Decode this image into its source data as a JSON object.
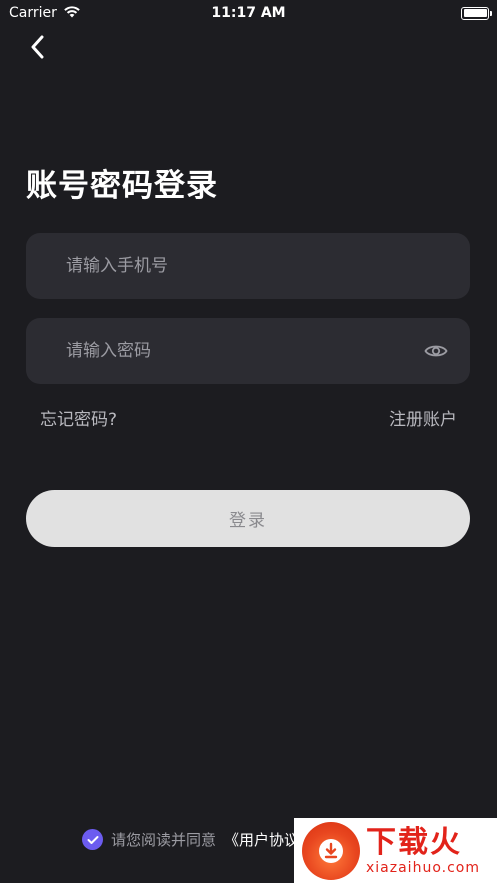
{
  "status_bar": {
    "carrier": "Carrier",
    "time": "11:17 AM"
  },
  "title": "账号密码登录",
  "phone": {
    "placeholder": "请输入手机号",
    "value": ""
  },
  "password": {
    "placeholder": "请输入密码",
    "value": ""
  },
  "links": {
    "forgot": "忘记密码?",
    "register": "注册账户"
  },
  "login_button": "登录",
  "agreement": {
    "text": "请您阅读并同意",
    "user_agreement": "《用户协议》"
  },
  "watermark": {
    "title": "下载火",
    "subtitle": "xiazaihuo.com"
  },
  "colors": {
    "background": "#1c1c20",
    "field": "#2c2c32",
    "button": "#e1e1e1",
    "check": "#6c5cf0",
    "brand_red": "#e2231a"
  },
  "icons": [
    "wifi-icon",
    "battery-icon",
    "back-chevron-icon",
    "eye-icon",
    "check-icon",
    "logo-icon"
  ]
}
